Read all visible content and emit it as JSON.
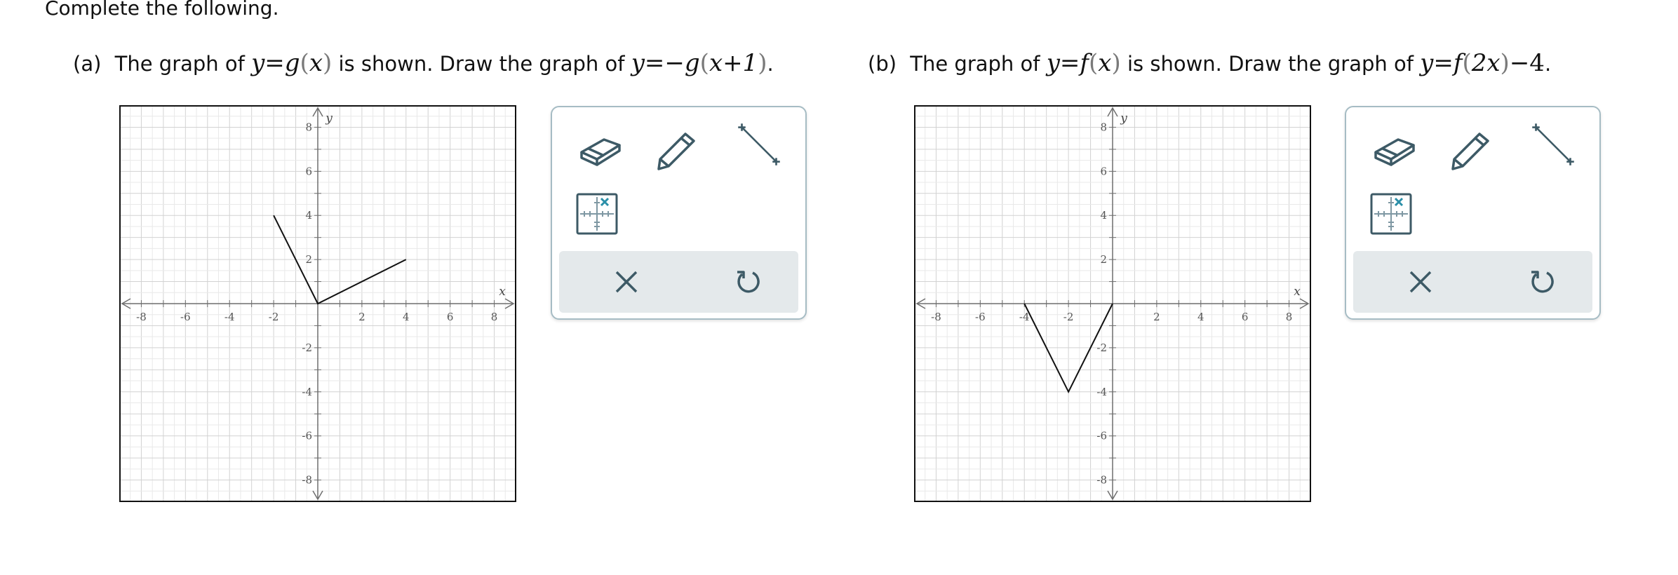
{
  "instructions": "Complete the following.",
  "parts": {
    "a": {
      "label": "(a)",
      "text_before": "The graph of",
      "given": {
        "lhs": "y",
        "eq": "=",
        "fn": "g",
        "arg": "x"
      },
      "text_middle": "is shown. Draw the graph of",
      "target": {
        "lhs": "y",
        "eq": "=",
        "neg": "−",
        "fn": "g",
        "arg": "x+1"
      },
      "end": "."
    },
    "b": {
      "label": "(b)",
      "text_before": "The graph of",
      "given": {
        "lhs": "y",
        "eq": "=",
        "fn": "f",
        "arg": "x"
      },
      "text_middle": "is shown. Draw the graph of",
      "target": {
        "lhs": "y",
        "eq": "=",
        "fn": "f",
        "arg": "2x",
        "tail": "−4"
      },
      "end": "."
    }
  },
  "graphs": [
    {
      "id": "a",
      "x_label": "x",
      "y_label": "y",
      "xlim": [
        -9,
        9
      ],
      "ylim": [
        -9,
        9
      ],
      "x_ticks": [
        "-8",
        "-6",
        "-4",
        "-2",
        "2",
        "4",
        "6",
        "8"
      ],
      "y_ticks": [
        "8",
        "6",
        "4",
        "2",
        "-2",
        "-4",
        "-6",
        "-8"
      ],
      "polyline": [
        [
          -2,
          4
        ],
        [
          0,
          0
        ],
        [
          4,
          2
        ]
      ]
    },
    {
      "id": "b",
      "x_label": "x",
      "y_label": "y",
      "xlim": [
        -9,
        9
      ],
      "ylim": [
        -9,
        9
      ],
      "x_ticks": [
        "-8",
        "-6",
        "-4",
        "-2",
        "2",
        "4",
        "6",
        "8"
      ],
      "y_ticks": [
        "8",
        "6",
        "4",
        "2",
        "-2",
        "-4",
        "-6",
        "-8"
      ],
      "polyline": [
        [
          -4,
          0
        ],
        [
          -2,
          -4
        ],
        [
          0,
          0
        ]
      ]
    }
  ],
  "toolbox": {
    "tools": [
      "eraser-icon",
      "pencil-icon",
      "line-segment-icon",
      "grid-icon"
    ],
    "actions": [
      "clear-x-icon",
      "undo-icon"
    ],
    "colors": {
      "border": "#a6bcc4",
      "icon": "#3d5a66",
      "accent": "#2b8fa8",
      "action_bar": "#e4e9eb"
    }
  }
}
